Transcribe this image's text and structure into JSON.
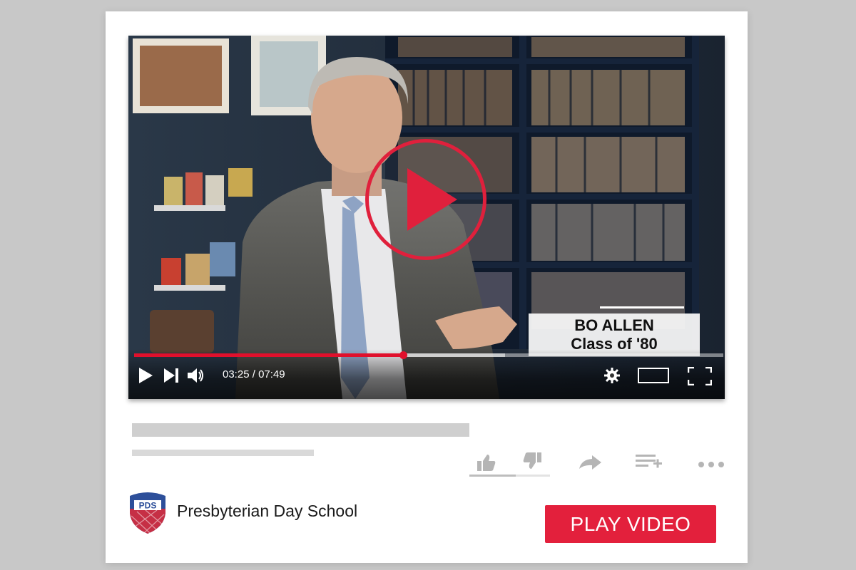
{
  "player": {
    "current_time": "03:25",
    "separator": " / ",
    "duration": "07:49",
    "progress_fraction": 0.4561,
    "buffered_fraction": 0.63,
    "lower_third": {
      "name": "BO ALLEN",
      "subtitle": "Class of '80"
    }
  },
  "channel": {
    "name": "Presbyterian Day School",
    "logo_text": "PDS"
  },
  "cta": {
    "label": "PLAY VIDEO"
  },
  "colors": {
    "accent": "#e3203c",
    "progress": "#e0102c",
    "background": "#c8c8c8"
  },
  "icons": {
    "play": "play-icon",
    "next": "next-icon",
    "volume": "volume-icon",
    "settings": "gear-icon",
    "theater": "theater-mode-icon",
    "fullscreen": "fullscreen-icon",
    "like": "thumbs-up-icon",
    "dislike": "thumbs-down-icon",
    "share": "share-icon",
    "add_to_playlist": "playlist-add-icon",
    "more": "more-icon"
  }
}
